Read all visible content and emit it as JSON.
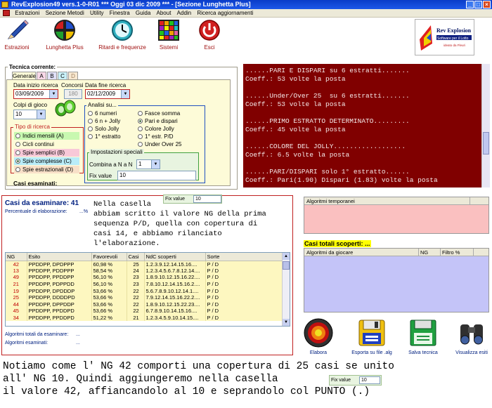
{
  "window": {
    "title": "RevExplosion49 vers.1-0-R01   ***   Oggi 03 dic 2009   ***   - [Sezione Lunghetta Plus]"
  },
  "menu": [
    "Estrazioni",
    "Sezione Metodi",
    "Utility",
    "Finestra",
    "Guida",
    "About",
    "Addin",
    "Ricerca aggiornamenti"
  ],
  "toolbar": {
    "estrazioni": "Estrazioni",
    "lunghetta": "Lunghetta Plus",
    "ritardi": "Ritardi e frequenze",
    "sistemi": "Sistemi",
    "esci": "Esci"
  },
  "logo": {
    "name": "Rev Explosion",
    "tagline": "Software per il Lotto",
    "sub": "ideato da Fleuri"
  },
  "tecnica": {
    "label": "Tecnica corrente:",
    "tabs": [
      "Generale",
      "A",
      "B",
      "C",
      "D"
    ],
    "data_inizio_label": "Data inizio ricerca",
    "data_inizio": "03/09/2009",
    "concorsi_label": "Concorsi",
    "concorsi": "180",
    "data_fine_label": "Data fine ricerca",
    "data_fine": "02/12/2009",
    "colpi_label": "Colpi di gioco",
    "colpi": "10",
    "tipo_label": "Tipo di ricerca",
    "tipo_items": [
      "Indici mensili (A)",
      "Cicli continui",
      "Spie semplici (B)",
      "Spie complesse (C)",
      "Spie estrazionali (D)"
    ],
    "casi_esaminati": "Casi esaminati:",
    "analisi_label": "Analisi su...",
    "analisi_left": [
      "6 numeri",
      "6 n + Jolly",
      "Solo Jolly",
      "1° estratto"
    ],
    "analisi_right": [
      "Fasce somma",
      "Pari e dispari",
      "Colore Jolly",
      "1° estr. P/D",
      "Under Over 25"
    ],
    "impostazioni_label": "Impostazioni speciali",
    "combina_label": "Combina a N a N",
    "combina_value": "1",
    "fixvalue_label": "Fix value",
    "fixvalue": "10"
  },
  "console": {
    "lines": [
      "......PARI E DISPARI su 6 estratti.......",
      "Coeff.: 53 volte la posta",
      "",
      "......Under/Over 25  su 6 estratti.......",
      "Coeff.: 53 volte la posta",
      "",
      "......PRIMO ESTRATTO DETERMINATO.........",
      "Coeff.: 45 volte la posta",
      "",
      "......COLORE DEL JOLLY..................",
      "Coeff.: 6.5 volte la posta",
      "",
      "......PARI/DISPARI solo 1° estratto......",
      "Coeff.: Pari(1.90) Dispari (1.83) volte la posta"
    ]
  },
  "casi": {
    "title": "Casi da esaminare: 41",
    "percentuale": "Percentuale di elaborazione:",
    "percentuale_unit": "...%",
    "overlay": "Nella casella\nabbiam scritto il valore NG della prima\nsequenza P/D, quella con copertura di\ncasi 14, e abbiamo rilanciato\nl'elaborazione.",
    "fix_label": "Fix value",
    "fix_value": "10",
    "columns": [
      "NG",
      "Esito",
      "Favorevoli",
      "Casi",
      "NdC scoperti",
      "Sorte"
    ],
    "rows": [
      [
        "42",
        "PPDDPP, DPDPPP",
        "60,98 %",
        "25",
        "1.2.3.9.12.14.15.16....",
        "P / D"
      ],
      [
        "13",
        "PPDDPP, PDDPPP",
        "58,54 %",
        "24",
        "1.2.3.4.5.6.7.8.12.14....",
        "P / D"
      ],
      [
        "49",
        "PPDDPP, PPDDPP",
        "56,10 %",
        "23",
        "1.8.9.10.12.15.16.22....",
        "P / D"
      ],
      [
        "21",
        "PPDDPP, PDPPDD",
        "56,10 %",
        "23",
        "7.8.10.12.14.15.16.2....",
        "P / D"
      ],
      [
        "19",
        "PPDDPP, DPDDDP",
        "53,66 %",
        "22",
        "5.6.7.8.9.10.12.14.1....",
        "P / D"
      ],
      [
        "25",
        "PPDDPP, DDDDPD",
        "53,66 %",
        "22",
        "7.9.12.14.15.16.22.2....",
        "P / D"
      ],
      [
        "44",
        "PPDDPP, DPPDDP",
        "53,66 %",
        "22",
        "1.8.9.10.12.15.22.23....",
        "P / D"
      ],
      [
        "45",
        "PPDDPP, PPDDPD",
        "53,66 %",
        "22",
        "6.7.8.9.10.14.15.16....",
        "P / D"
      ],
      [
        "34",
        "PPDDPP, PPDDPD",
        "51,22 %",
        "21",
        "1.2.3.4.5.9.10.14.15....",
        "P / D"
      ]
    ],
    "alg_totali": "Algoritmi totali da esaminare:",
    "alg_totali_val": "...",
    "alg_esaminati": "Algoritmi esaminati:",
    "alg_esaminati_val": "..."
  },
  "right": {
    "alg_temp_header": "Algoritmi temporanei",
    "casi_totali": "Casi totali scoperti: ...",
    "alg_giocare_cols": [
      "Algoritmi da giocare",
      "NG",
      "Filtro %"
    ]
  },
  "buttons": {
    "elabora": "Elabora",
    "esporta": "Esporta su file .alg",
    "salva": "Salva tecnica",
    "visualizza": "Visualizza esiti"
  },
  "bottom": {
    "line1": "Notiamo come l' NG 42 comporti una copertura di 25 casi se unito",
    "line2": "all' NG 10. Quindi aggiungeremo nella casella",
    "line3": "il valore 42, affiancandolo al 10 e seprandolo col PUNTO (.)",
    "fix_label": "Fix value",
    "fix_value": "10"
  },
  "colors": {
    "titlebar": "#1d58e8",
    "console_bg": "#800000",
    "panel_yellow": "#fdfbd8",
    "table_row": "#fdf7c0",
    "alg_temp_bg": "#fac0c0",
    "alg_giocare_bg": "#c4c4f8",
    "accent_red": "#c02020"
  }
}
